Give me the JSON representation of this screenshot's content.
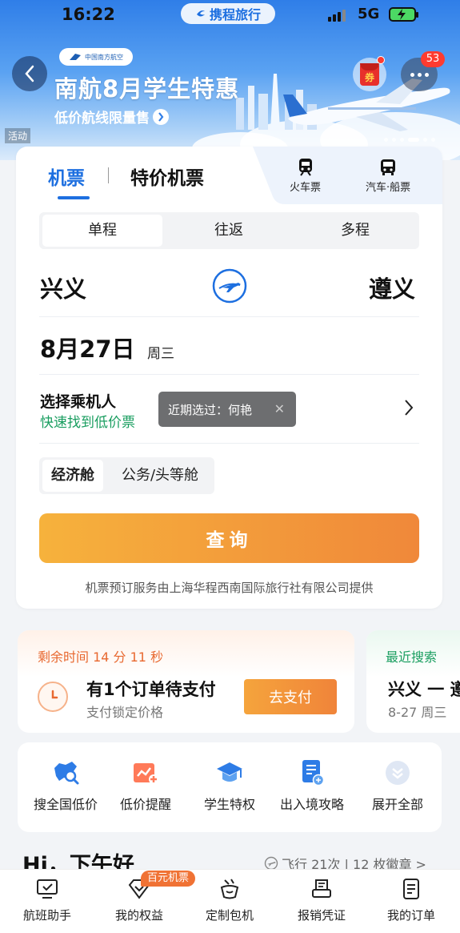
{
  "status_bar": {
    "time": "16:22",
    "app_brand": "携程旅行",
    "network": "5G"
  },
  "banner": {
    "airline_logo_text": "中国南方航空",
    "title": "南航8月学生特惠",
    "subtitle": "低价航线限量售",
    "tag": "活动",
    "coupon_label": "券",
    "message_count": "53"
  },
  "tabs": {
    "flight": "机票",
    "special": "特价机票",
    "train": "火车票",
    "bus_ship": "汽车·船票"
  },
  "trip_types": [
    "单程",
    "往返",
    "多程"
  ],
  "route": {
    "from": "兴义",
    "to": "遵义"
  },
  "date": {
    "day": "8月27日",
    "weekday": "周三"
  },
  "passenger": {
    "title": "选择乘机人",
    "subtitle": "快速找到低价票",
    "recent_hint": "近期选过：何艳"
  },
  "cabins": [
    "经济舱",
    "公务/头等舱"
  ],
  "search_label": "查询",
  "provider_note": "机票预订服务由上海华程西南国际旅行社有限公司提供",
  "pending_order": {
    "timer": "剩余时间 14 分 11 秒",
    "title": "有1个订单待支付",
    "subtitle": "支付锁定价格",
    "pay_label": "去支付"
  },
  "recent_search": {
    "label": "最近搜索",
    "route": "兴义 一 遵",
    "date": "8-27 周三"
  },
  "quick_menu": [
    {
      "label": "搜全国低价",
      "icon": "china-map-search-icon"
    },
    {
      "label": "低价提醒",
      "icon": "price-alert-chart-icon"
    },
    {
      "label": "学生特权",
      "icon": "graduation-cap-icon"
    },
    {
      "label": "出入境攻略",
      "icon": "document-guide-icon"
    },
    {
      "label": "展开全部",
      "icon": "chevron-down-circle-icon"
    }
  ],
  "greeting": "Hi，下午好",
  "fly_stats": "飞行 21次 | 12 枚徽章 >",
  "bottom_nav": [
    {
      "label": "航班助手",
      "icon": "monitor-check-icon"
    },
    {
      "label": "我的权益",
      "icon": "diamond-heart-icon"
    },
    {
      "label": "定制包机",
      "icon": "custom-charter-icon"
    },
    {
      "label": "报销凭证",
      "icon": "receipt-printer-icon"
    },
    {
      "label": "我的订单",
      "icon": "order-list-icon"
    }
  ],
  "nav_badge": "百元机票",
  "colors": {
    "accent_blue": "#1d6fe0",
    "green": "#1a9e60",
    "orange": "#f0883a"
  }
}
